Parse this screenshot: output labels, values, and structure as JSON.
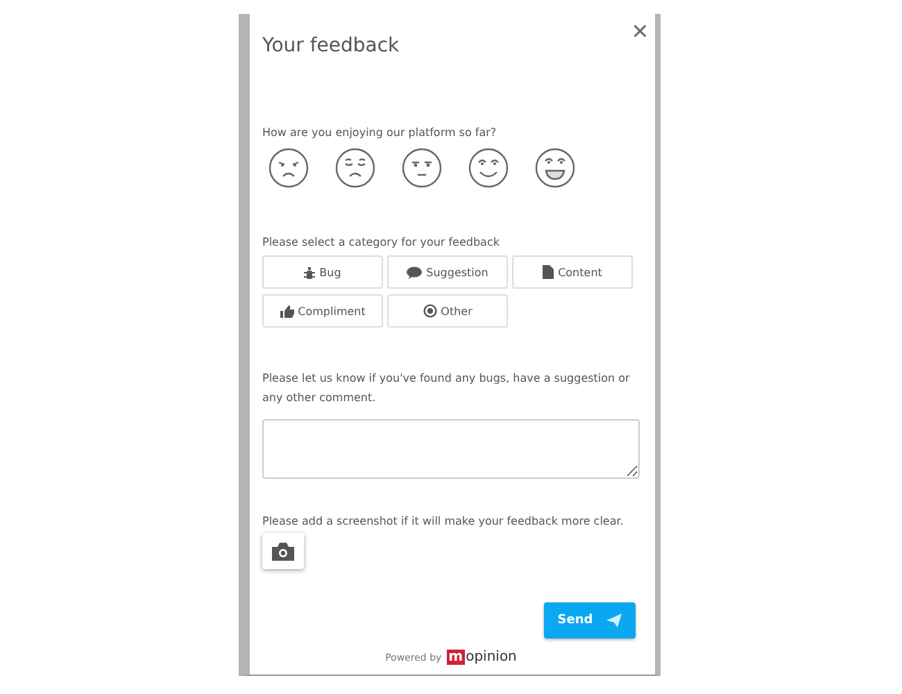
{
  "dialog": {
    "title": "Your feedback",
    "close": "×"
  },
  "rating": {
    "question": "How are you enjoying our platform so far?",
    "faces": [
      {
        "kind": "angry"
      },
      {
        "kind": "sad"
      },
      {
        "kind": "neutral"
      },
      {
        "kind": "happy"
      },
      {
        "kind": "grin"
      }
    ]
  },
  "category": {
    "label": "Please select a category for your feedback",
    "options": [
      {
        "kind": "bug",
        "label": "Bug"
      },
      {
        "kind": "suggestion",
        "label": "Suggestion"
      },
      {
        "kind": "content",
        "label": "Content"
      },
      {
        "kind": "compliment",
        "label": "Compliment"
      },
      {
        "kind": "other",
        "label": "Other"
      }
    ]
  },
  "comment": {
    "label": "Please let us know if you've found any bugs, have a suggestion or any other comment."
  },
  "screenshot": {
    "label": "Please add a screenshot if it will make your feedback more clear."
  },
  "send_button": "Send",
  "footer": {
    "powered_by": "Powered by",
    "logo_mark": "m",
    "logo_text": "opinion"
  }
}
